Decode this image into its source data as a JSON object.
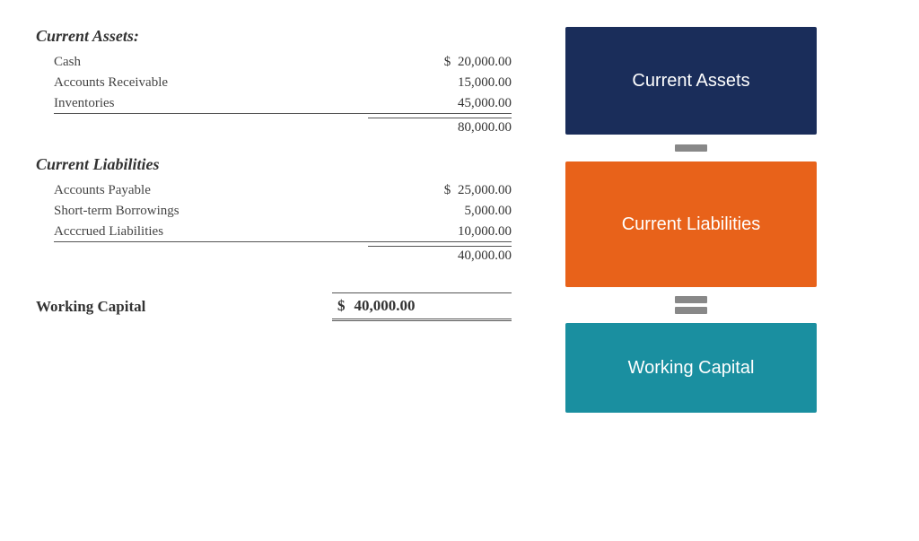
{
  "currentAssets": {
    "title": "Current Assets:",
    "items": [
      {
        "label": "Cash",
        "dollar": "$",
        "amount": "20,000.00"
      },
      {
        "label": "Accounts Receivable",
        "dollar": "",
        "amount": "15,000.00"
      },
      {
        "label": "Inventories",
        "dollar": "",
        "amount": "45,000.00"
      }
    ],
    "subtotal": "80,000.00"
  },
  "currentLiabilities": {
    "title": "Current Liabilities",
    "items": [
      {
        "label": "Accounts Payable",
        "dollar": "$",
        "amount": "25,000.00"
      },
      {
        "label": "Short-term Borrowings",
        "dollar": "",
        "amount": "5,000.00"
      },
      {
        "label": "Acccrued Liabilities",
        "dollar": "",
        "amount": "10,000.00"
      }
    ],
    "subtotal": "40,000.00"
  },
  "workingCapital": {
    "label": "Working Capital",
    "dollar": "$",
    "amount": "40,000.00"
  },
  "rightPanel": {
    "currentAssetsLabel": "Current Assets",
    "currentLiabilitiesLabel": "Current Liabilities",
    "workingCapitalLabel": "Working Capital"
  },
  "colors": {
    "navy": "#1a2d5a",
    "orange": "#e8621a",
    "teal": "#1a8fa0",
    "connectorGray": "#888"
  }
}
